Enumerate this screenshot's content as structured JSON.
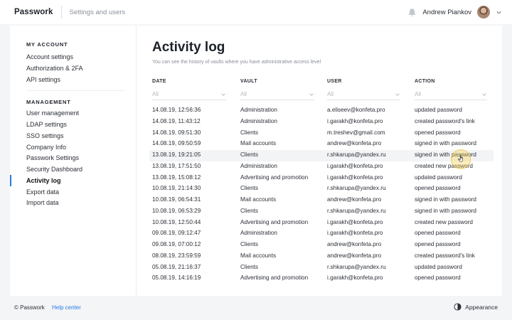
{
  "header": {
    "logo": "Passwork",
    "subtitle": "Settings and users",
    "user_name": "Andrew Piankov"
  },
  "sidebar": {
    "sections": [
      {
        "title": "MY ACCOUNT",
        "items": [
          "Account settings",
          "Authorization & 2FA",
          "API settings"
        ]
      },
      {
        "title": "MANAGEMENT",
        "items": [
          "User management",
          "LDAP settings",
          "SSO settings",
          "Company Info",
          "Passwork Settings",
          "Security Dashboard",
          "Activity log",
          "Export data",
          "Import data"
        ]
      }
    ],
    "active_item": "Activity log"
  },
  "main": {
    "title": "Activity log",
    "subtitle": "You can see the history of vaults where you have administrative access level",
    "columns": [
      {
        "label": "DATE",
        "filter": "All"
      },
      {
        "label": "VAULT",
        "filter": "All"
      },
      {
        "label": "USER",
        "filter": "All"
      },
      {
        "label": "ACTION",
        "filter": "All"
      }
    ],
    "rows": [
      [
        "14.08.19, 12:56:36",
        "Administration",
        "a.eliseev@konfeta.pro",
        "updated password"
      ],
      [
        "14.08.19, 11:43:12",
        "Administration",
        "i.garakh@konfeta.pro",
        "created password's link"
      ],
      [
        "14.08.19, 09:51:30",
        "Clients",
        "m.treshev@gmail.com",
        "opened password"
      ],
      [
        "14.08.19, 09:50:59",
        "Mail accounts",
        "andrew@konfeta.pro",
        "signed in with password"
      ],
      [
        "13.08.19, 19:21:05",
        "Clients",
        "r.shkarupa@yandex.ru",
        "signed in with password"
      ],
      [
        "13.08.19, 17:51:50",
        "Administration",
        "i.garakh@konfeta.pro",
        "created new password"
      ],
      [
        "13.08.19, 15:08:12",
        "Advertising and promotion",
        "i.garakh@konfeta.pro",
        "updated password"
      ],
      [
        "10.08.19, 21:14:30",
        "Clients",
        "r.shkarupa@yandex.ru",
        "opened password"
      ],
      [
        "10.08.19, 06:54:31",
        "Mail accounts",
        "andrew@konfeta.pro",
        "signed in with password"
      ],
      [
        "10.08.19, 06:53:29",
        "Clients",
        "r.shkarupa@yandex.ru",
        "signed in with password"
      ],
      [
        "10.08.19, 12:50:44",
        "Advertising and promotion",
        "i.garakh@konfeta.pro",
        "created new password"
      ],
      [
        "09.08.19, 09:12:47",
        "Administration",
        "i.garakh@konfeta.pro",
        "opened password"
      ],
      [
        "09.08.19, 07:00:12",
        "Clients",
        "andrew@konfeta.pro",
        "opened password"
      ],
      [
        "08.08.19, 23:59:59",
        "Mail accounts",
        "andrew@konfeta.pro",
        "created password's link"
      ],
      [
        "05.08.19, 21:16:37",
        "Clients",
        "r.shkarupa@yandex.ru",
        "updated password"
      ],
      [
        "05.08.19, 14:16:19",
        "Advertising and promotion",
        "i.garakh@konfeta.pro",
        "opened password"
      ]
    ]
  },
  "footer": {
    "copyright": "© Passwork",
    "help": "Help center",
    "appearance": "Appearance"
  },
  "colors": {
    "accent": "#2c7be5",
    "highlight": "#f5ce46"
  }
}
